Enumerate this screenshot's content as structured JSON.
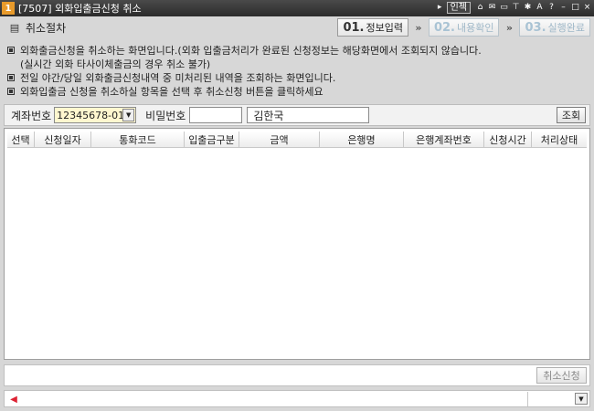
{
  "window": {
    "number_badge": "1",
    "title": "[7507] 외화입출금신청 취소",
    "inject_label": "인젝"
  },
  "header": {
    "page_title": "취소절차",
    "steps": [
      {
        "num": "01.",
        "label": "정보입력",
        "state": "active"
      },
      {
        "num": "02.",
        "label": "내용확인",
        "state": "inactive"
      },
      {
        "num": "03.",
        "label": "실행완료",
        "state": "inactive"
      }
    ],
    "step_arrow": "»"
  },
  "notes": [
    "외화출금신청을 취소하는 화면입니다.(외화 입출금처리가 완료된 신청정보는 해당화면에서 조회되지 않습니다.",
    "(실시간 외화 타사이체출금의 경우 취소 불가)",
    "전일 야간/당일 외화출금신청내역 중 미처리된 내역을 조회하는 화면입니다.",
    "외화입출금 신청을 취소하실 항목을 선택 후 취소신청 버튼을 클릭하세요"
  ],
  "search": {
    "account_label": "계좌번호",
    "account_value": "12345678-01",
    "password_label": "비밀번호",
    "password_value": "",
    "account_holder": "김한국",
    "query_button": "조회"
  },
  "grid": {
    "columns": [
      "선택",
      "신청일자",
      "통화코드",
      "입출금구분",
      "금액",
      "은행명",
      "은행계좌번호",
      "신청시간",
      "처리상태"
    ],
    "rows": []
  },
  "actions": {
    "cancel_request_button": "취소신청"
  },
  "status": {
    "message": ""
  },
  "colors": {
    "title_bar": "#333333",
    "badge": "#e89a2a",
    "account_field_bg": "#fff7cf",
    "inactive_step": "#a9c3d4"
  },
  "icons": {
    "window_badge": "number-badge-icon",
    "header": "document-list-icon",
    "status": "speaker-icon"
  }
}
